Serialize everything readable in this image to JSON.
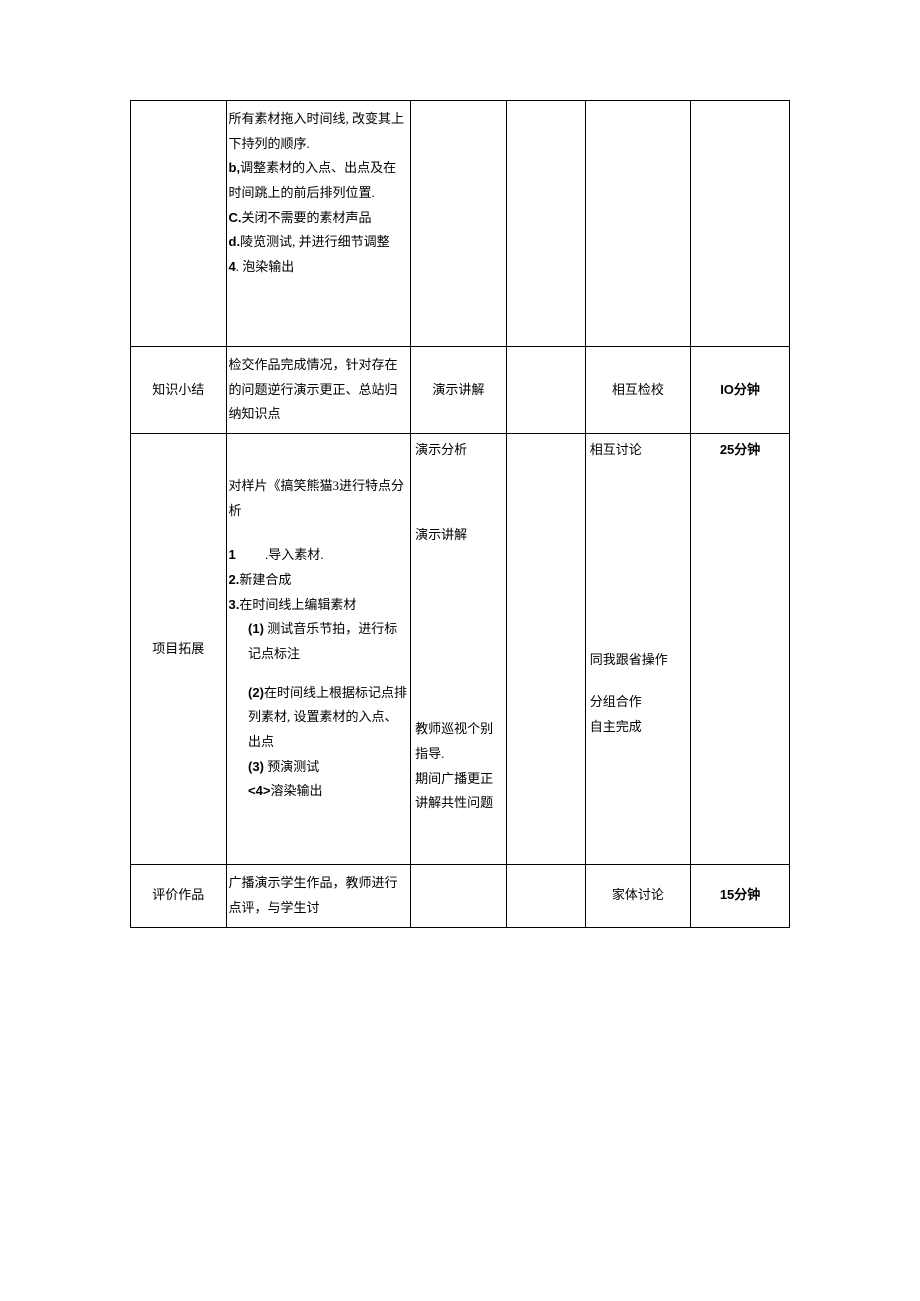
{
  "rows": [
    {
      "col1": "",
      "col2_lines": [
        "所有素材拖入时间线, 改变其上下持列的顺序.",
        "b,调整素材的入点、出点及在时间跳上的前后排列位置.",
        "C.关闭不需要的素材声品",
        "d.陵览测试, 并进行细节调整",
        "4. 泡染输出"
      ],
      "col3": "",
      "col4": "",
      "col5": "",
      "col6": ""
    },
    {
      "col1": "知识小结",
      "col2": "检交作品完成情况，针对存在的问题逆行演示更正、总站归纳知识点",
      "col3": "演示讲解",
      "col4": "",
      "col5": "相互检校",
      "col6": "IO分钟"
    },
    {
      "col1": "项目拓展",
      "col2_p1": "对样片《搞笑熊猫3进行特点分析",
      "col2_items": [
        "1           .导入素材.",
        "2.新建合成",
        "3.在时间线上编辑素材"
      ],
      "col2_sub": [
        "(1) 测试音乐节拍，进行标记点标注",
        "(2)在时间线上根据标记点排列素材, 设置素材的入点、出点",
        "(3) 预演测试",
        "<4>溶染输出"
      ],
      "col3_a": "演示分析",
      "col3_b": "演示讲解",
      "col3_c": "教师巡视个别指导.",
      "col3_d": "期间广播更正讲解共性问题",
      "col4": "",
      "col5_a": "相互讨论",
      "col5_b": "同我跟省操作",
      "col5_c": "分组合作",
      "col5_d": "自主完成",
      "col6": "25分钟"
    },
    {
      "col1": "评价作品",
      "col2": "广播演示学生作品，教师进行点评，与学生讨",
      "col3": "",
      "col4": "",
      "col5": "家体讨论",
      "col6": "15分钟"
    }
  ]
}
